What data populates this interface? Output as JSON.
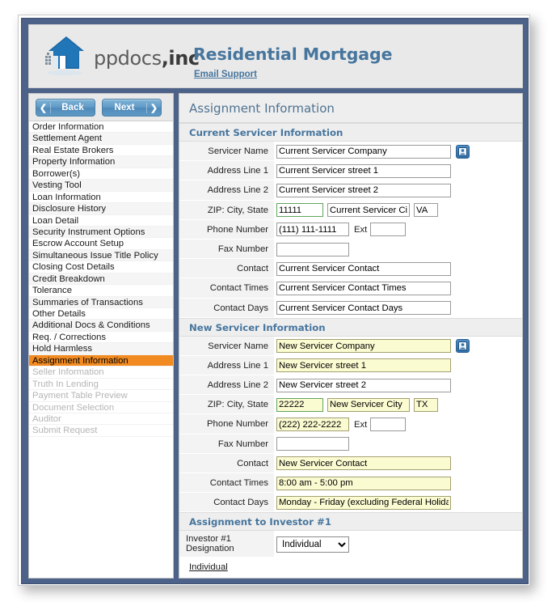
{
  "brand": {
    "logo_icon": "house-n-logo-icon",
    "name_light": "ppdocs",
    "name_bold": ",inc",
    "product_title": "Residential Mortgage",
    "email_support": "Email Support"
  },
  "nav": {
    "back_label": "Back",
    "next_label": "Next",
    "back_icon": "chevron-left-icon",
    "next_icon": "chevron-right-icon",
    "items": [
      {
        "label": "Order Information",
        "state": "normal"
      },
      {
        "label": "Settlement Agent",
        "state": "normal"
      },
      {
        "label": "Real Estate Brokers",
        "state": "normal"
      },
      {
        "label": "Property Information",
        "state": "normal"
      },
      {
        "label": "Borrower(s)",
        "state": "normal"
      },
      {
        "label": "Vesting Tool",
        "state": "normal"
      },
      {
        "label": "Loan Information",
        "state": "normal"
      },
      {
        "label": "Disclosure History",
        "state": "normal"
      },
      {
        "label": "Loan Detail",
        "state": "normal"
      },
      {
        "label": "Security Instrument Options",
        "state": "normal"
      },
      {
        "label": "Escrow Account Setup",
        "state": "normal"
      },
      {
        "label": "Simultaneous Issue Title Policy",
        "state": "normal"
      },
      {
        "label": "Closing Cost Details",
        "state": "normal"
      },
      {
        "label": "Credit Breakdown",
        "state": "normal"
      },
      {
        "label": "Tolerance",
        "state": "normal"
      },
      {
        "label": "Summaries of Transactions",
        "state": "normal"
      },
      {
        "label": "Other Details",
        "state": "normal"
      },
      {
        "label": "Additional Docs & Conditions",
        "state": "normal"
      },
      {
        "label": "Req. / Corrections",
        "state": "normal"
      },
      {
        "label": "Hold Harmless",
        "state": "normal"
      },
      {
        "label": "Assignment Information",
        "state": "active"
      },
      {
        "label": "Seller Information",
        "state": "disabled"
      },
      {
        "label": "Truth In Lending",
        "state": "disabled"
      },
      {
        "label": "Payment Table Preview",
        "state": "disabled"
      },
      {
        "label": "Document Selection",
        "state": "disabled"
      },
      {
        "label": "Auditor",
        "state": "disabled"
      },
      {
        "label": "Submit Request",
        "state": "disabled"
      }
    ]
  },
  "page": {
    "title": "Assignment Information"
  },
  "sections": {
    "current_servicer": {
      "heading": "Current Servicer Information",
      "labels": {
        "servicer_name": "Servicer Name",
        "address1": "Address Line 1",
        "address2": "Address Line 2",
        "zip_city_state": "ZIP: City, State",
        "phone": "Phone Number",
        "ext": "Ext",
        "fax": "Fax Number",
        "contact": "Contact",
        "contact_times": "Contact Times",
        "contact_days": "Contact Days"
      },
      "values": {
        "servicer_name": "Current Servicer Company",
        "address1": "Current Servicer street 1",
        "address2": "Current Servicer street 2",
        "zip": "11111",
        "city": "Current Servicer City",
        "state": "VA",
        "phone": "(111) 111-1111",
        "ext": "",
        "fax": "",
        "contact": "Current Servicer Contact",
        "contact_times": "Current Servicer Contact Times",
        "contact_days": "Current Servicer Contact Days"
      },
      "address_book_icon": "address-book-icon"
    },
    "new_servicer": {
      "heading": "New Servicer Information",
      "labels": {
        "servicer_name": "Servicer Name",
        "address1": "Address Line 1",
        "address2": "Address Line 2",
        "zip_city_state": "ZIP: City, State",
        "phone": "Phone Number",
        "ext": "Ext",
        "fax": "Fax Number",
        "contact": "Contact",
        "contact_times": "Contact Times",
        "contact_days": "Contact Days"
      },
      "values": {
        "servicer_name": "New Servicer Company",
        "address1": "New Servicer street 1",
        "address2": "New Servicer street 2",
        "zip": "22222",
        "city": "New Servicer City",
        "state": "TX",
        "phone": "(222) 222-2222",
        "ext": "",
        "fax": "",
        "contact": "New Servicer Contact",
        "contact_times": "8:00 am - 5:00 pm",
        "contact_days": "Monday - Friday (excluding Federal Holidays)"
      },
      "address_book_icon": "address-book-icon"
    },
    "investor": {
      "heading": "Assignment to Investor #1",
      "designation_label_line1": "Investor #1",
      "designation_label_line2": "Designation",
      "designation_value": "Individual",
      "designation_options": [
        "Individual"
      ],
      "individual_link": "Individual"
    }
  },
  "colors": {
    "frame_blue": "#4d6288",
    "accent_blue": "#46759d",
    "active_orange": "#f18b21",
    "required_yellow": "#fbfbd2",
    "valid_green": "#5fa55f"
  }
}
